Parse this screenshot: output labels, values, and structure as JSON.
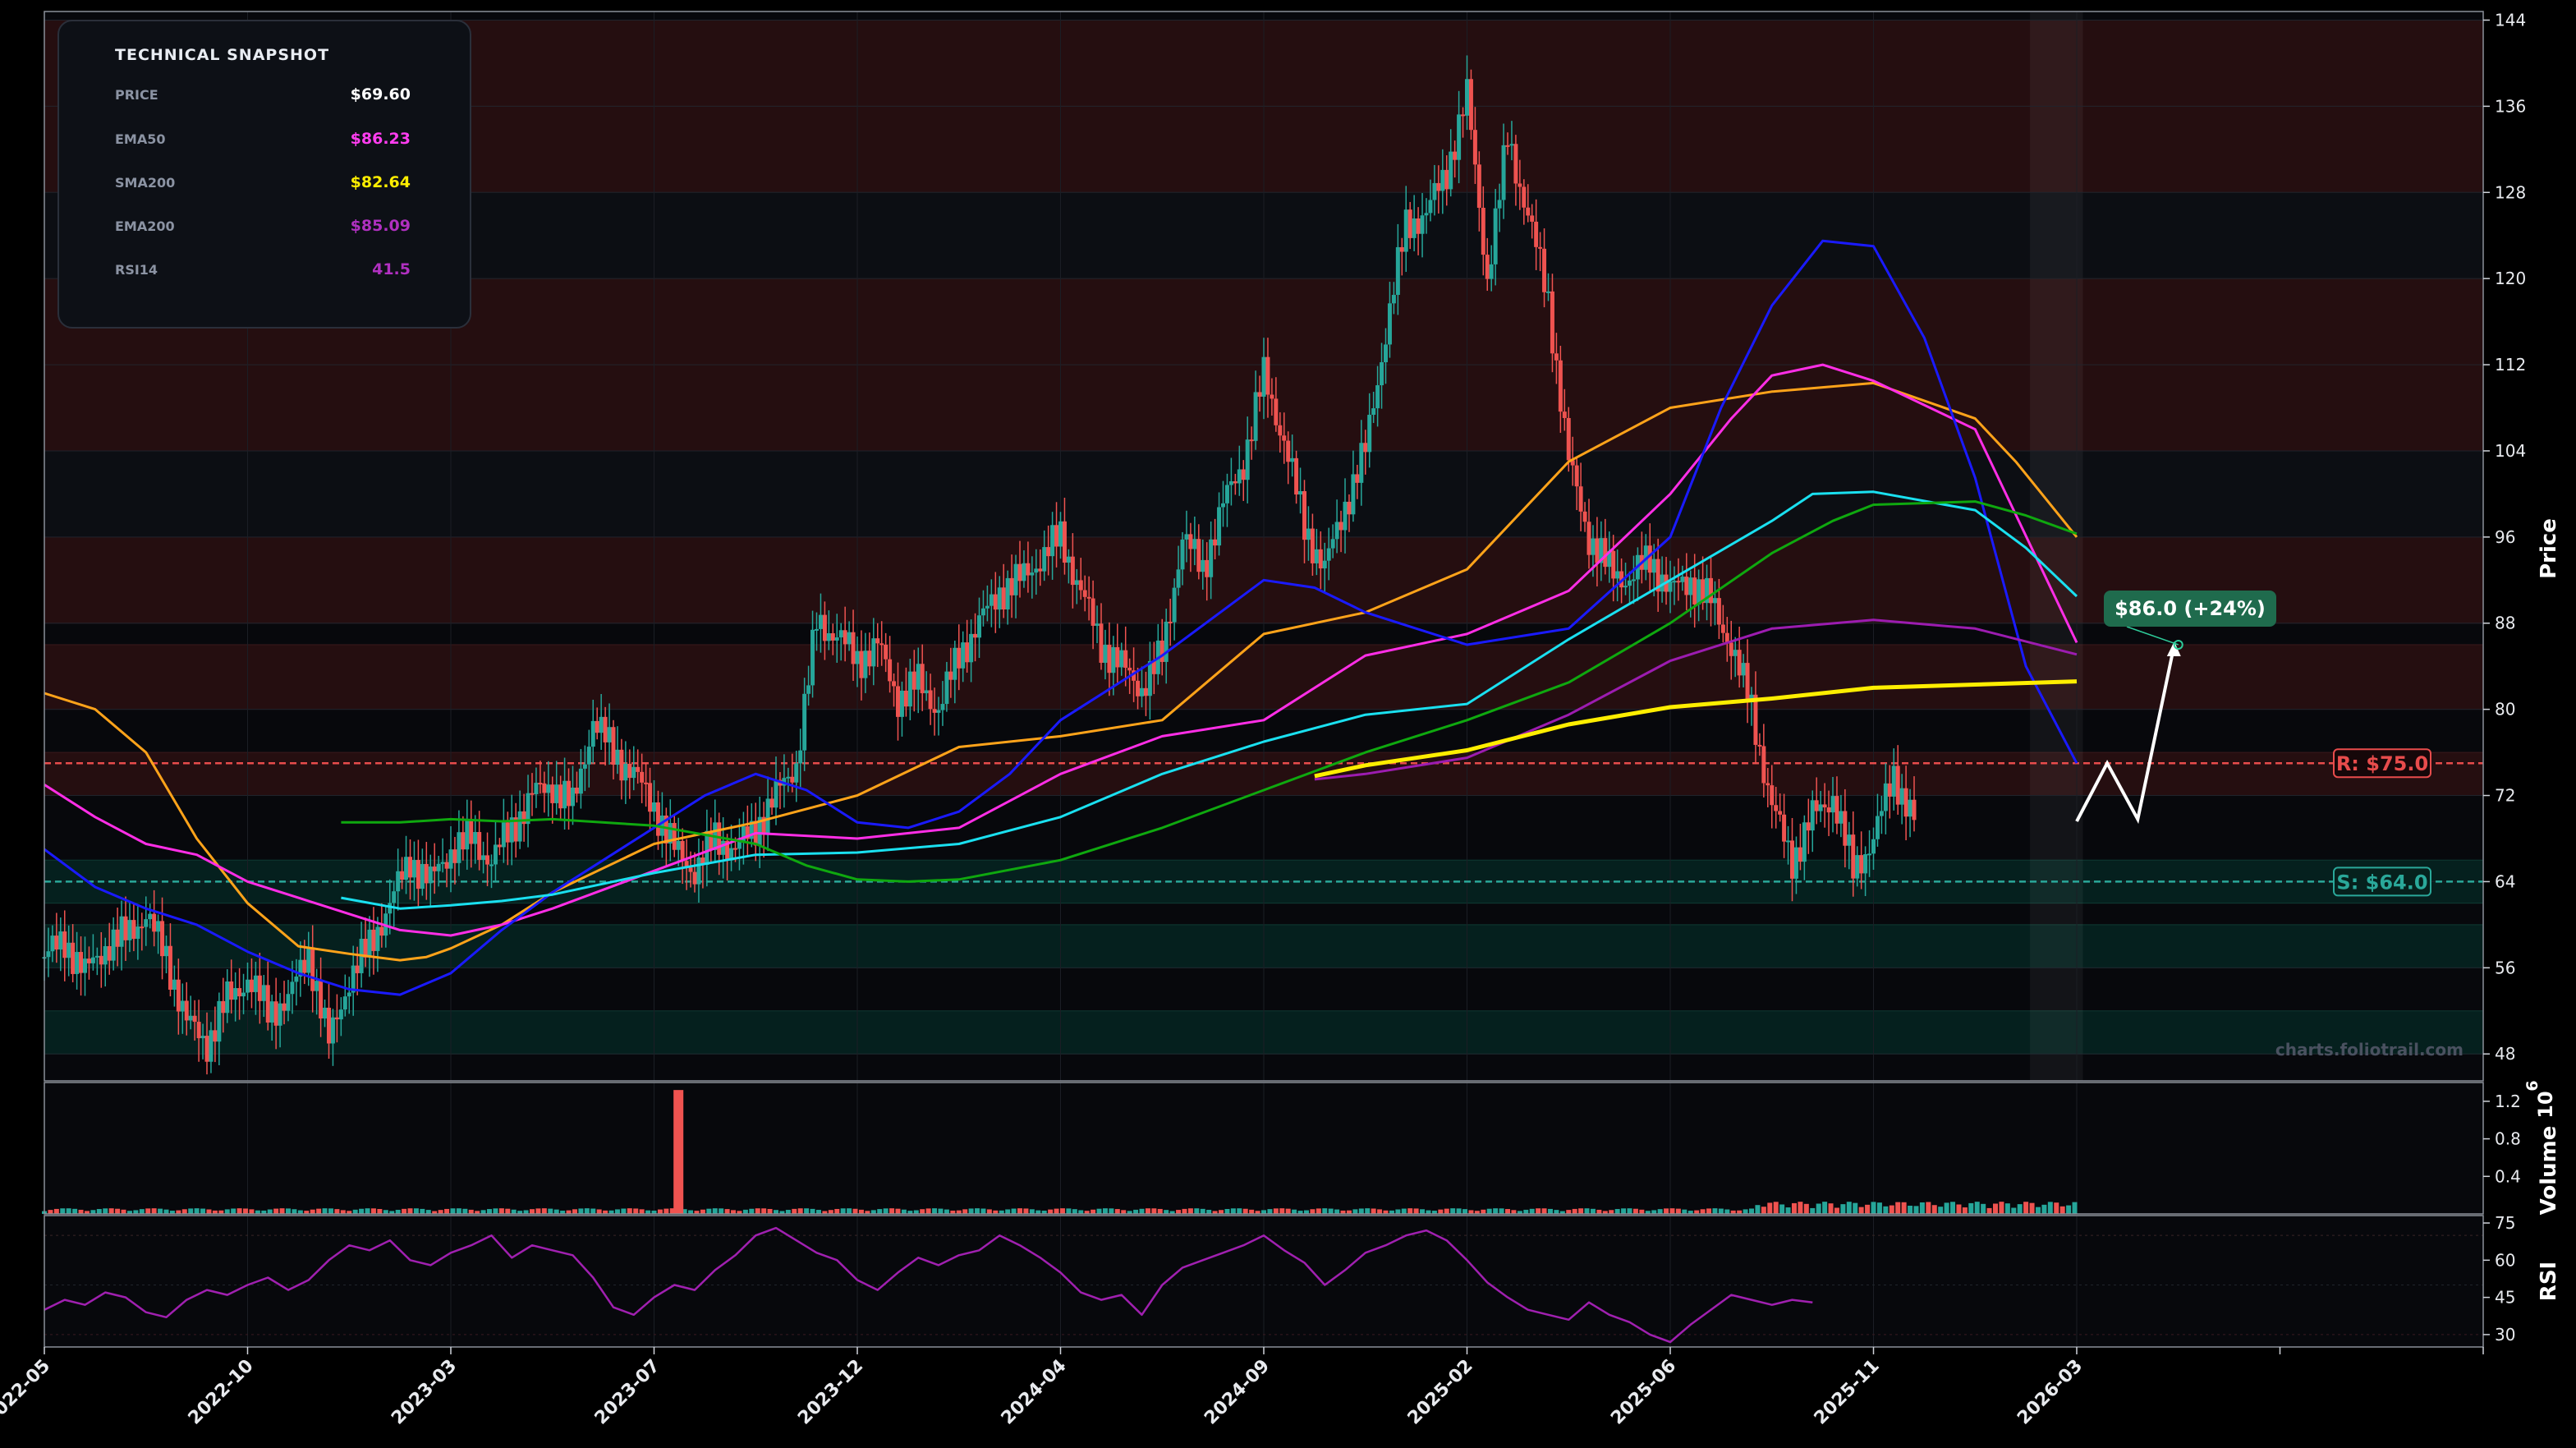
{
  "snapshot": {
    "title": "TECHNICAL SNAPSHOT",
    "rows": [
      {
        "label": "PRICE",
        "value": "$69.60",
        "color": "#ffffff"
      },
      {
        "label": "EMA50",
        "value": "$86.23",
        "color": "#ff3df0"
      },
      {
        "label": "SMA200",
        "value": "$82.64",
        "color": "#ffee00"
      },
      {
        "label": "EMA200",
        "value": "$85.09",
        "color": "#b030c0"
      },
      {
        "label": "RSI14",
        "value": "41.5",
        "color": "#b030c0"
      }
    ]
  },
  "chart_data": {
    "type": "line",
    "price_axis": {
      "label": "Price",
      "ticks": [
        "144",
        "136",
        "128",
        "120",
        "112",
        "104",
        "96",
        "88",
        "80",
        "72",
        "64",
        "56",
        "48"
      ],
      "ylim": [
        45.5,
        144.8
      ]
    },
    "volume_axis": {
      "label": "Volume",
      "exponent": "6",
      "ticks": [
        "1.2",
        "0.8",
        "0.4"
      ],
      "ylim": [
        0,
        1.4
      ]
    },
    "rsi_axis": {
      "label": "RSI",
      "ticks": [
        "75",
        "60",
        "45",
        "30"
      ],
      "ylim": [
        25,
        78
      ]
    },
    "x_axis": {
      "ticks": [
        "2022-05",
        "2022-10",
        "2023-03",
        "2023-07",
        "2023-12",
        "2024-04",
        "2024-09",
        "2025-02",
        "2025-06",
        "2025-11",
        "2026-03"
      ]
    },
    "x_range": [
      0,
      1200
    ],
    "data_end_x": 1000,
    "forecast_band_x": [
      977,
      1003
    ],
    "zones": {
      "resistance": [
        [
          136,
          144
        ],
        [
          128,
          136
        ],
        [
          112,
          120
        ],
        [
          104,
          112
        ],
        [
          88,
          96
        ],
        [
          80,
          86
        ],
        [
          72,
          76
        ]
      ],
      "neutral": [
        [
          120,
          128
        ],
        [
          96,
          104
        ]
      ],
      "support": [
        [
          62,
          66
        ],
        [
          56,
          60
        ],
        [
          48,
          52
        ]
      ]
    },
    "levels": {
      "resistance": {
        "value": 75.0,
        "label": "R: $75.0",
        "color": "#e84c4c"
      },
      "support": {
        "value": 64.0,
        "label": "S: $64.0",
        "color": "#2aa89a"
      }
    },
    "series": [
      {
        "key": "orange",
        "color": "#ffa31a",
        "width": 3,
        "x": [
          0,
          25,
          50,
          75,
          100,
          125,
          150,
          175,
          188,
          200,
          225,
          250,
          300,
          350,
          400,
          450,
          500,
          550,
          600,
          650,
          700,
          750,
          800,
          850,
          900,
          950,
          970,
          1000
        ],
        "y": [
          81.5,
          80,
          76,
          68,
          62,
          58,
          57.3,
          56.7,
          57,
          57.8,
          60,
          63,
          67.5,
          69.5,
          72,
          76.5,
          77.5,
          79,
          87,
          89,
          93,
          103,
          108,
          109.5,
          110.3,
          107,
          103,
          96
        ]
      },
      {
        "key": "ema50",
        "color": "#ff2ee6",
        "width": 3,
        "x": [
          0,
          25,
          50,
          75,
          100,
          125,
          150,
          175,
          200,
          225,
          250,
          300,
          350,
          400,
          450,
          500,
          550,
          600,
          650,
          700,
          750,
          800,
          830,
          850,
          875,
          900,
          950,
          1000
        ],
        "y": [
          73,
          70,
          67.5,
          66.5,
          64,
          62.5,
          61,
          59.5,
          59,
          60,
          61.5,
          65,
          68.5,
          68,
          69,
          74,
          77.5,
          79,
          85,
          87,
          91,
          100,
          107,
          111,
          112,
          110.5,
          106,
          86.2
        ]
      },
      {
        "key": "blue",
        "color": "#1a1aff",
        "width": 3,
        "x": [
          0,
          25,
          50,
          75,
          100,
          125,
          150,
          175,
          200,
          225,
          250,
          300,
          325,
          350,
          375,
          400,
          425,
          450,
          475,
          500,
          550,
          600,
          625,
          650,
          700,
          750,
          800,
          825,
          850,
          875,
          900,
          925,
          950,
          975,
          1000
        ],
        "y": [
          67,
          63.5,
          61.5,
          60,
          57.5,
          55.5,
          54,
          53.5,
          55.5,
          59.5,
          63,
          69,
          72,
          74,
          72.5,
          69.5,
          69,
          70.5,
          74,
          79,
          85,
          92,
          91.3,
          89,
          86,
          87.5,
          96,
          108,
          117.5,
          123.5,
          123,
          114.5,
          101.5,
          84,
          75
        ]
      },
      {
        "key": "cyan",
        "color": "#1ae0f0",
        "width": 3,
        "x": [
          146,
          175,
          200,
          225,
          250,
          300,
          350,
          400,
          450,
          500,
          550,
          600,
          650,
          700,
          750,
          800,
          850,
          870,
          900,
          950,
          975,
          1000
        ],
        "y": [
          62.5,
          61.5,
          61.8,
          62.2,
          62.8,
          64.8,
          66.5,
          66.7,
          67.5,
          70,
          74,
          77,
          79.5,
          80.5,
          86.5,
          92,
          97.5,
          100,
          100.2,
          98.5,
          95,
          90.5
        ]
      },
      {
        "key": "green",
        "color": "#0fa80f",
        "width": 3,
        "x": [
          146,
          175,
          200,
          225,
          250,
          300,
          350,
          375,
          400,
          425,
          450,
          500,
          550,
          600,
          650,
          700,
          750,
          800,
          850,
          880,
          900,
          950,
          975,
          1000
        ],
        "y": [
          69.5,
          69.5,
          69.8,
          69.6,
          69.8,
          69.2,
          67.5,
          65.5,
          64.2,
          64,
          64.2,
          66,
          69,
          72.5,
          76,
          79,
          82.5,
          88,
          94.5,
          97.5,
          99,
          99.3,
          98,
          96.3
        ]
      },
      {
        "key": "ema200",
        "color": "#9c1cb0",
        "width": 3,
        "x": [
          625,
          650,
          700,
          750,
          800,
          850,
          900,
          950,
          1000
        ],
        "y": [
          73.5,
          74,
          75.5,
          79.5,
          84.5,
          87.5,
          88.3,
          87.5,
          85.1
        ]
      },
      {
        "key": "sma200",
        "color": "#ffee00",
        "width": 5,
        "x": [
          625,
          650,
          700,
          750,
          800,
          850,
          900,
          950,
          1000
        ],
        "y": [
          73.8,
          74.8,
          76.2,
          78.6,
          80.2,
          81,
          82,
          82.3,
          82.6
        ]
      }
    ],
    "close": {
      "x": [
        0,
        10,
        20,
        30,
        40,
        50,
        60,
        70,
        80,
        90,
        100,
        110,
        120,
        130,
        140,
        150,
        160,
        170,
        180,
        190,
        200,
        210,
        220,
        230,
        240,
        250,
        260,
        270,
        280,
        290,
        300,
        310,
        320,
        330,
        340,
        350,
        360,
        370,
        380,
        390,
        400,
        410,
        420,
        430,
        440,
        450,
        460,
        470,
        480,
        490,
        500,
        510,
        520,
        530,
        540,
        550,
        560,
        570,
        580,
        590,
        600,
        610,
        620,
        630,
        640,
        650,
        660,
        670,
        680,
        690,
        700,
        710,
        720,
        730,
        740,
        750,
        760,
        770,
        780,
        790,
        800,
        810,
        820,
        830,
        840,
        850,
        860,
        870,
        880,
        890,
        900,
        910,
        920,
        930,
        940,
        950,
        960,
        970,
        980,
        990,
        1000
      ],
      "y": [
        57,
        58.5,
        55.5,
        58,
        59,
        61,
        57,
        51,
        49,
        53,
        55,
        52,
        53,
        57.5,
        49,
        55,
        58,
        62,
        66,
        64,
        67,
        68,
        66,
        69,
        72,
        73,
        71,
        79,
        76,
        74,
        71,
        67,
        65,
        68,
        67,
        69,
        72,
        75,
        88,
        87,
        84.5,
        86,
        81,
        82.5,
        80,
        85,
        88,
        91,
        92,
        94,
        96,
        91,
        86,
        84,
        82,
        85,
        96,
        93,
        99,
        103,
        111,
        105,
        97,
        93,
        99,
        104,
        115,
        125,
        126,
        130,
        137,
        120,
        133,
        126,
        118,
        103,
        96,
        93,
        92,
        94,
        91,
        92,
        90,
        86,
        80,
        71,
        66,
        70,
        72,
        65,
        68,
        74,
        69.6
      ]
    },
    "forecast": {
      "x": [
        1000,
        1015,
        1030,
        1048
      ],
      "y": [
        69.6,
        75,
        69.8,
        86
      ],
      "label": "$86.0 (+24%)"
    },
    "volume": {
      "spike_x": 312,
      "spike_value": 1.32
    },
    "rsi": {
      "x": [
        0,
        10,
        20,
        30,
        40,
        50,
        60,
        70,
        80,
        90,
        100,
        110,
        120,
        130,
        140,
        150,
        160,
        170,
        180,
        190,
        200,
        210,
        220,
        230,
        240,
        250,
        260,
        270,
        280,
        290,
        300,
        310,
        320,
        330,
        340,
        350,
        360,
        370,
        380,
        390,
        400,
        410,
        420,
        430,
        440,
        450,
        460,
        470,
        480,
        490,
        500,
        510,
        520,
        530,
        540,
        550,
        560,
        570,
        580,
        590,
        600,
        610,
        620,
        630,
        640,
        650,
        660,
        670,
        680,
        690,
        700,
        710,
        720,
        730,
        740,
        750,
        760,
        770,
        780,
        790,
        800,
        810,
        820,
        830,
        840,
        850,
        860,
        870,
        880,
        890,
        900,
        910,
        920,
        930,
        940,
        950,
        960,
        970,
        980,
        990,
        1000
      ],
      "y": [
        40,
        44,
        42,
        47,
        45,
        39,
        37,
        44,
        48,
        46,
        50,
        53,
        48,
        52,
        60,
        66,
        64,
        68,
        60,
        58,
        63,
        66,
        70,
        61,
        66,
        64,
        62,
        53,
        41,
        38,
        45,
        50,
        48,
        56,
        62,
        70,
        73,
        68,
        63,
        60,
        52,
        48,
        55,
        61,
        58,
        62,
        64,
        70,
        66,
        61,
        55,
        47,
        44,
        46,
        38,
        50,
        57,
        60,
        63,
        66,
        70,
        64,
        59,
        50,
        56,
        63,
        66,
        70,
        72,
        68,
        60,
        51,
        45,
        40,
        38,
        36,
        43,
        38,
        35,
        30,
        27,
        34,
        40,
        46,
        44,
        42,
        44,
        43
      ]
    },
    "watermark": "charts.foliotrail.com"
  }
}
